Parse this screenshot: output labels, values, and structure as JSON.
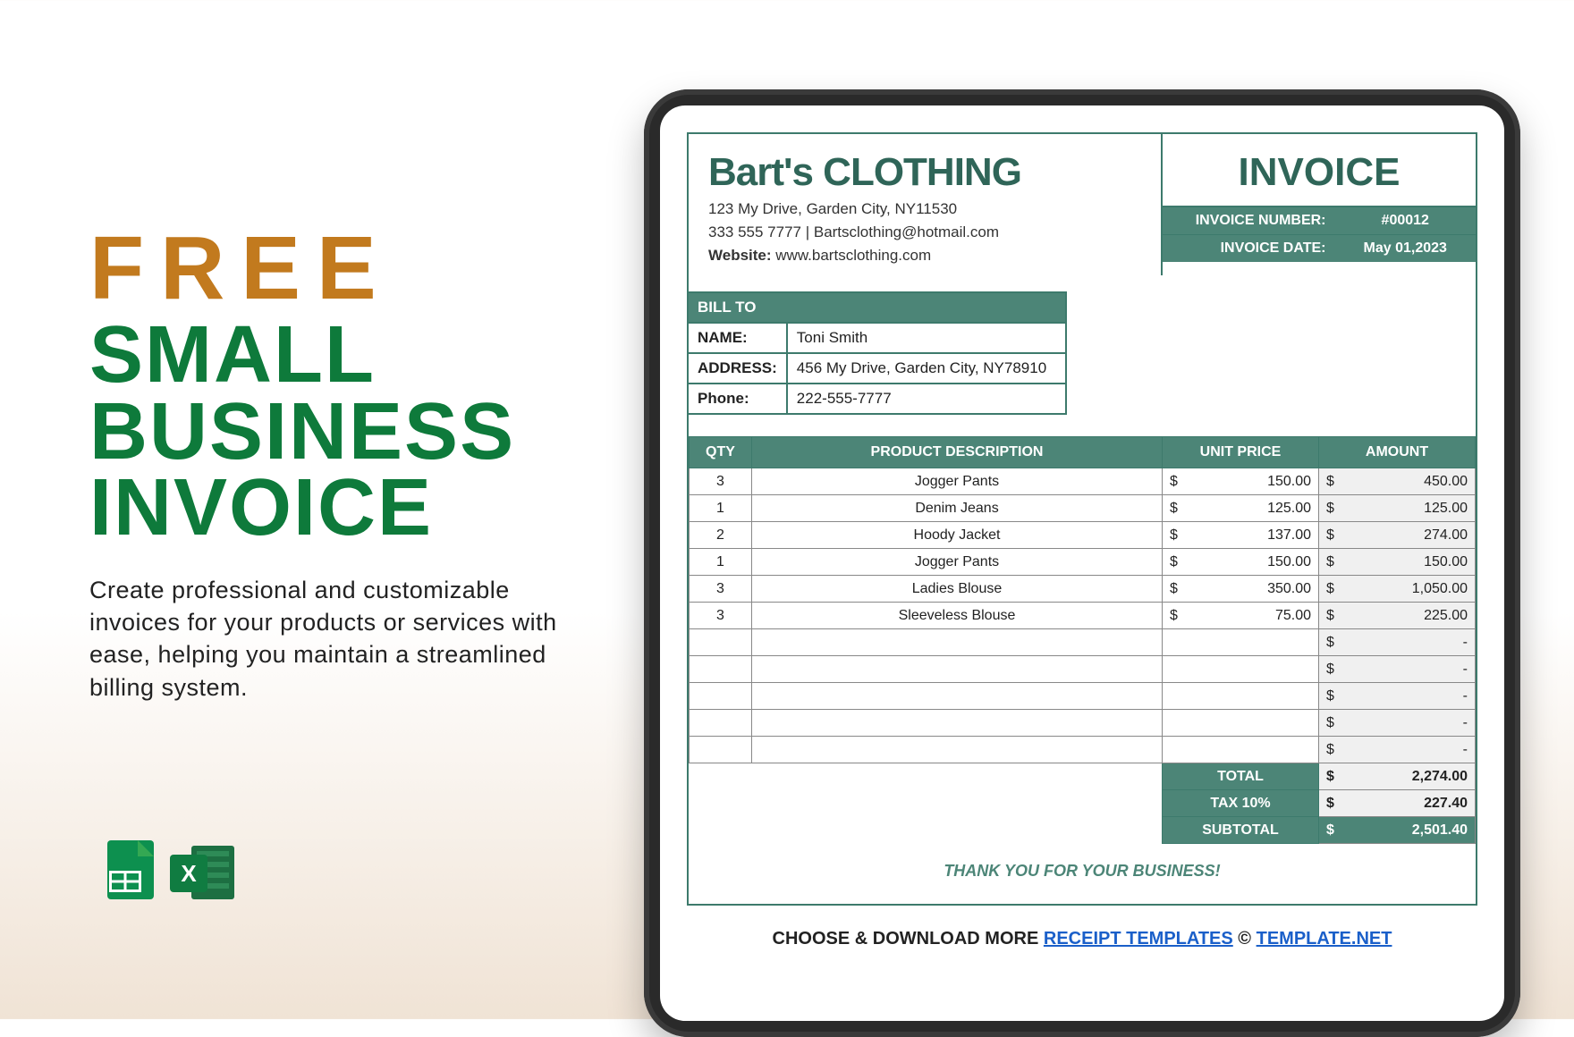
{
  "promo": {
    "free": "FREE",
    "title": "SMALL BUSINESS INVOICE",
    "desc": "Create professional and customizable invoices for your products or services with ease, helping you maintain a streamlined billing system."
  },
  "icons": {
    "sheets": "google-sheets-icon",
    "excel": "microsoft-excel-icon",
    "excel_letter": "X"
  },
  "company": {
    "name": "Bart's CLOTHING",
    "address": "123 My Drive, Garden City, NY11530",
    "phone_email": "333 555 7777 | Bartsclothing@hotmail.com",
    "website_label": "Website:",
    "website": "www.bartsclothing.com"
  },
  "invoice": {
    "title": "INVOICE",
    "number_label": "INVOICE NUMBER:",
    "number": "#00012",
    "date_label": "INVOICE DATE:",
    "date": "May 01,2023"
  },
  "billto": {
    "header": "BILL TO",
    "name_label": "NAME:",
    "name": "Toni Smith",
    "address_label": "ADDRESS:",
    "address": "456 My Drive, Garden City, NY78910",
    "phone_label": "Phone:",
    "phone": "222-555-7777"
  },
  "columns": {
    "qty": "QTY",
    "desc": "PRODUCT DESCRIPTION",
    "unit": "UNIT PRICE",
    "amount": "AMOUNT"
  },
  "currency": "$",
  "lines": [
    {
      "qty": "3",
      "desc": "Jogger Pants",
      "unit": "150.00",
      "amount": "450.00"
    },
    {
      "qty": "1",
      "desc": "Denim Jeans",
      "unit": "125.00",
      "amount": "125.00"
    },
    {
      "qty": "2",
      "desc": "Hoody Jacket",
      "unit": "137.00",
      "amount": "274.00"
    },
    {
      "qty": "1",
      "desc": "Jogger Pants",
      "unit": "150.00",
      "amount": "150.00"
    },
    {
      "qty": "3",
      "desc": "Ladies Blouse",
      "unit": "350.00",
      "amount": "1,050.00"
    },
    {
      "qty": "3",
      "desc": "Sleeveless Blouse",
      "unit": "75.00",
      "amount": "225.00"
    },
    {
      "qty": "",
      "desc": "",
      "unit": "",
      "amount": "-"
    },
    {
      "qty": "",
      "desc": "",
      "unit": "",
      "amount": "-"
    },
    {
      "qty": "",
      "desc": "",
      "unit": "",
      "amount": "-"
    },
    {
      "qty": "",
      "desc": "",
      "unit": "",
      "amount": "-"
    },
    {
      "qty": "",
      "desc": "",
      "unit": "",
      "amount": "-"
    }
  ],
  "totals": {
    "total_label": "TOTAL",
    "total": "2,274.00",
    "tax_label": "TAX  10%",
    "tax": "227.40",
    "subtotal_label": "SUBTOTAL",
    "subtotal": "2,501.40"
  },
  "thanks": "THANK YOU FOR YOUR BUSINESS!",
  "footer": {
    "prefix": "CHOOSE & DOWNLOAD MORE ",
    "link1": "RECEIPT TEMPLATES",
    "mid": "  ©  ",
    "link2": "TEMPLATE.NET"
  }
}
